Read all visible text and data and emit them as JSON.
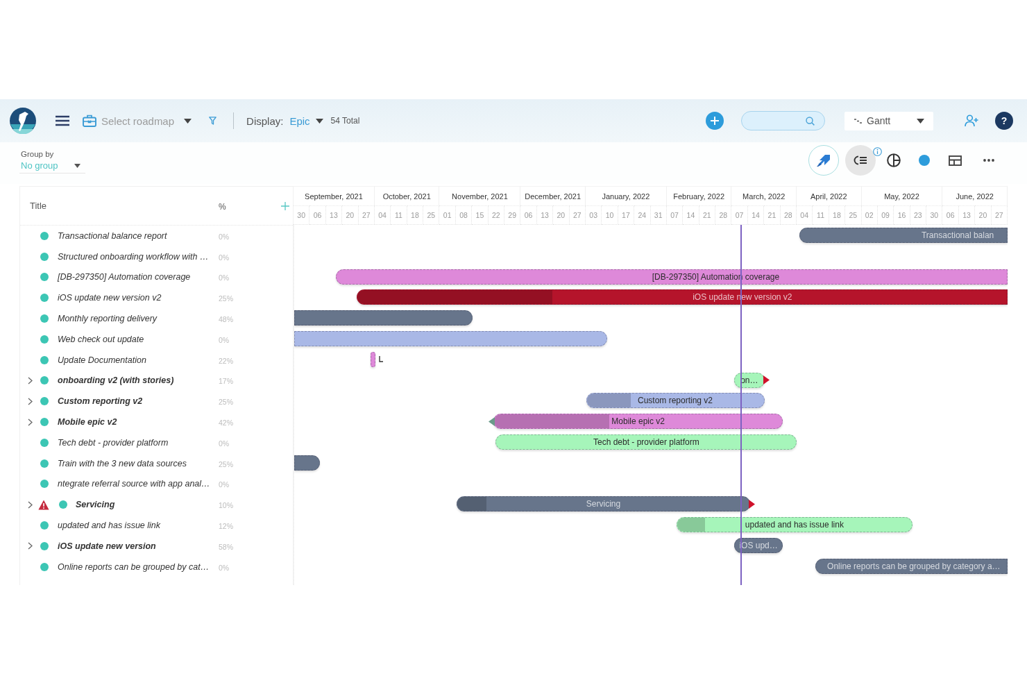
{
  "topbar": {
    "roadmap_select": {
      "placeholder": "Select roadmap"
    },
    "display": {
      "label": "Display:",
      "value": "Epic"
    },
    "total": "54 Total",
    "view_select": {
      "value": "Gantt"
    },
    "help": "?"
  },
  "toolbar": {
    "group_by": {
      "label": "Group by",
      "value": "No group"
    },
    "tools": [
      {
        "kind": "arrows",
        "selected": true,
        "hovered": false,
        "info": false
      },
      {
        "kind": "outline",
        "selected": false,
        "hovered": true,
        "info": true
      },
      {
        "kind": "pie",
        "selected": false,
        "hovered": false,
        "info": false
      },
      {
        "kind": "dot",
        "selected": false,
        "hovered": false,
        "info": false
      },
      {
        "kind": "layout",
        "selected": false,
        "hovered": false,
        "info": false
      },
      {
        "kind": "more",
        "selected": false,
        "hovered": false,
        "info": false
      }
    ]
  },
  "list": {
    "columns": [
      "Title",
      "%"
    ]
  },
  "timeline": {
    "months": [
      {
        "label": "September, 2021",
        "weeks": [
          "30",
          "06",
          "13",
          "20",
          "27"
        ]
      },
      {
        "label": "October, 2021",
        "weeks": [
          "04",
          "11",
          "18",
          "25"
        ]
      },
      {
        "label": "November, 2021",
        "weeks": [
          "01",
          "08",
          "15",
          "22",
          "29"
        ]
      },
      {
        "label": "December, 2021",
        "weeks": [
          "06",
          "13",
          "20",
          "27"
        ]
      },
      {
        "label": "January, 2022",
        "weeks": [
          "03",
          "10",
          "17",
          "24",
          "31"
        ]
      },
      {
        "label": "February, 2022",
        "weeks": [
          "07",
          "14",
          "21",
          "28"
        ]
      },
      {
        "label": "March, 2022",
        "weeks": [
          "07",
          "14",
          "21",
          "28"
        ]
      },
      {
        "label": "April, 2022",
        "weeks": [
          "04",
          "11",
          "18",
          "25"
        ]
      },
      {
        "label": "May, 2022",
        "weeks": [
          "02",
          "09",
          "16",
          "23",
          "30"
        ]
      },
      {
        "label": "June, 2022",
        "weeks": [
          "06",
          "13",
          "20",
          "27"
        ]
      }
    ]
  },
  "rows": [
    {
      "title": "Transactional balance report",
      "kind": "item",
      "warning": false,
      "percent": "0%",
      "bar": {
        "color": "#67758b",
        "label": "Transactional balan",
        "start_marker": false,
        "end_marker": false,
        "link": false
      }
    },
    {
      "title": "Structured onboarding workflow with …",
      "kind": "item",
      "warning": false,
      "percent": "0%"
    },
    {
      "title": "[DB-297350] Automation coverage",
      "kind": "item",
      "warning": false,
      "percent": "0%",
      "bar": {
        "color": "#de89d9",
        "label": "[DB-297350] Automation coverage",
        "start_marker": false,
        "end_marker": false,
        "link": false
      }
    },
    {
      "title": "iOS update new version v2",
      "kind": "item",
      "warning": false,
      "percent": "25%",
      "bar": {
        "color": "#b5142b",
        "level": 0.3,
        "label": "iOS update new version v2",
        "start_marker": false,
        "end_marker": false,
        "link": false
      }
    },
    {
      "title": "Monthly reporting delivery",
      "kind": "item",
      "warning": false,
      "percent": "48%",
      "bar": {
        "color": "#67758b",
        "start_marker": false,
        "end_marker": false,
        "link": false
      }
    },
    {
      "title": "Web check out update",
      "kind": "item",
      "warning": false,
      "percent": "0%",
      "bar": {
        "color": "#a9b8e6",
        "start_marker": false,
        "end_marker": false,
        "link": false
      }
    },
    {
      "title": "Update Documentation",
      "kind": "item",
      "warning": false,
      "percent": "22%",
      "bar": {
        "color": "#de89d9",
        "start_marker": false,
        "end_marker": false,
        "link": true
      }
    },
    {
      "title": "onboarding v2 (with stories)",
      "kind": "group",
      "warning": false,
      "percent": "17%",
      "bar": {
        "color": "#a6f5ba",
        "label": "on…",
        "start_marker": false,
        "end_marker": true,
        "link": false
      }
    },
    {
      "title": "Custom reporting v2",
      "kind": "group",
      "warning": false,
      "percent": "25%",
      "bar": {
        "color": "#a9b8e6",
        "level": 0.25,
        "label": "Custom reporting v2",
        "start_marker": false,
        "end_marker": false,
        "link": false
      }
    },
    {
      "title": "Mobile epic v2",
      "kind": "group",
      "warning": false,
      "percent": "42%",
      "bar": {
        "color": "#de89d9",
        "level": 0.4,
        "label": "Mobile epic v2",
        "start_marker": true,
        "end_marker": false,
        "link": false
      }
    },
    {
      "title": "Tech debt - provider platform",
      "kind": "item",
      "warning": false,
      "percent": "0%",
      "bar": {
        "color": "#a6f5ba",
        "label": "Tech debt - provider platform",
        "start_marker": false,
        "end_marker": false,
        "link": false
      }
    },
    {
      "title": "Train with the 3 new data sources",
      "kind": "item",
      "warning": false,
      "percent": "25%",
      "bar": {
        "color": "#67758b",
        "start_marker": false,
        "end_marker": false,
        "link": false
      }
    },
    {
      "title": "ntegrate referral source with app anal…",
      "kind": "item",
      "warning": false,
      "percent": "0%"
    },
    {
      "title": "Servicing",
      "kind": "group",
      "warning": true,
      "percent": "10%",
      "bar": {
        "color": "#67758b",
        "level": 0.1,
        "label": "Servicing",
        "start_marker": false,
        "end_marker": true,
        "link": false
      }
    },
    {
      "title": "updated and has issue link",
      "kind": "item",
      "warning": false,
      "percent": "12%",
      "bar": {
        "color": "#a6f5ba",
        "level": 0.12,
        "label": "updated and has issue link",
        "start_marker": false,
        "end_marker": false,
        "link": false
      }
    },
    {
      "title": "iOS update new version",
      "kind": "group",
      "warning": false,
      "percent": "58%",
      "bar": {
        "color": "#67758b",
        "label": "iOS upd…",
        "start_marker": false,
        "end_marker": false,
        "link": false
      }
    },
    {
      "title": "Online reports can be grouped by cat…",
      "kind": "item",
      "warning": false,
      "percent": "0%",
      "bar": {
        "color": "#67758b",
        "label": "Online reports can be grouped by category a…",
        "start_marker": false,
        "end_marker": false,
        "link": false
      }
    }
  ]
}
